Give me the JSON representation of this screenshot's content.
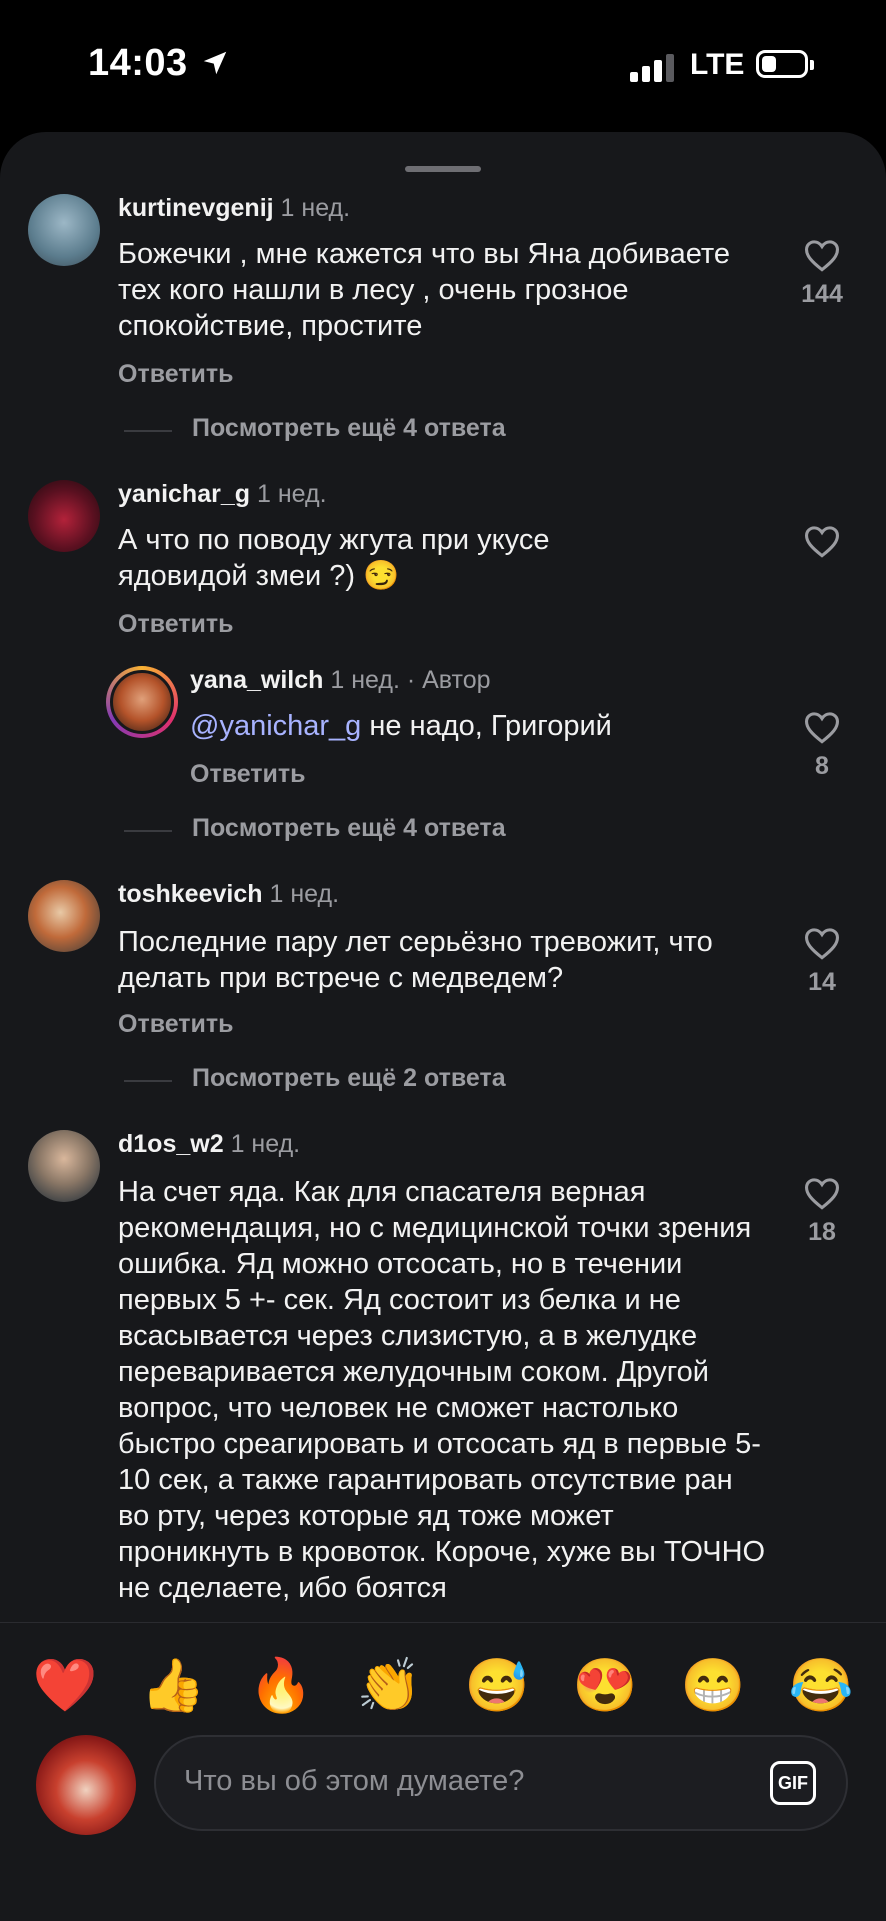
{
  "status_bar": {
    "time": "14:03",
    "network": "LTE"
  },
  "comments": [
    {
      "username": "kurtinevgenij",
      "time": "1 нед.",
      "text": "Божечки , мне кажется что вы Яна добиваете тех кого нашли в лесу , очень грозное спокойствие, простите",
      "reply_label": "Ответить",
      "likes": "144",
      "more_replies": "Посмотреть ещё 4 ответа"
    },
    {
      "username": "yanichar_g",
      "time": "1 нед.",
      "text": "А что по поводу жгута при укусе ядовидой змеи ?) 😏",
      "reply_label": "Ответить",
      "likes": "",
      "reply": {
        "username": "yana_wilch",
        "time": "1 нед.",
        "author_tag": "· Автор",
        "mention": "@yanichar_g",
        "text": " не надо, Григорий",
        "reply_label": "Ответить",
        "likes": "8"
      },
      "more_replies": "Посмотреть ещё 4 ответа"
    },
    {
      "username": "toshkeevich",
      "time": "1 нед.",
      "text": "Последние пару лет серьёзно тревожит, что делать при встрече с медведем?",
      "reply_label": "Ответить",
      "likes": "14",
      "more_replies": "Посмотреть ещё 2 ответа"
    },
    {
      "username": "d1os_w2",
      "time": "1 нед.",
      "text": "На счет яда. Как для спасателя верная рекомендация, но с медицинской точки зрения ошибка. Яд можно отсосать, но в течении первых 5 +- сек. Яд состоит из белка и не всасывается через слизистую, а в желудке переваривается желудочным соком. Другой вопрос, что человек не сможет настолько быстро среагировать и отсосать яд в первые 5-10 сек, а также гарантировать отсутствие ран во рту, через которые яд тоже может проникнуть в кровоток. Короче, хуже вы ТОЧНО не сделаете, ибо боятся",
      "likes": "18"
    }
  ],
  "quick_reactions": [
    "❤️",
    "👍",
    "🔥",
    "👏",
    "😅",
    "😍",
    "😁",
    "😂"
  ],
  "composer": {
    "placeholder": "Что вы об этом думаете?",
    "gif_label": "GIF"
  },
  "colors": {
    "sheet_bg": "#17181b",
    "mention": "#a8b3ff",
    "muted": "#9b9ca1"
  }
}
